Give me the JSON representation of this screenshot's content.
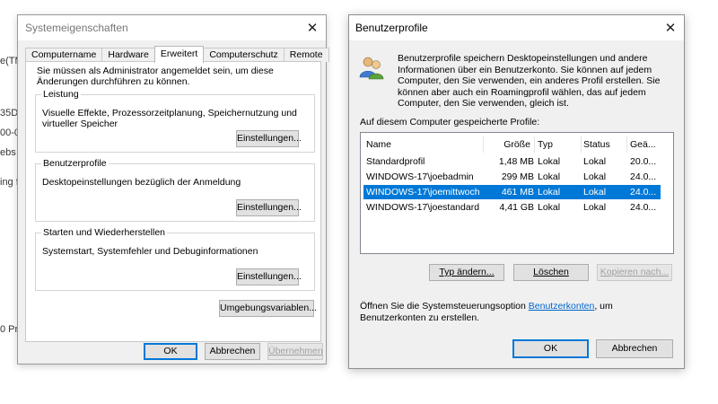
{
  "background": {
    "fragments": [
      "e(TM",
      "35D",
      "00-0",
      "ebs",
      "ing f",
      "0 Pro"
    ]
  },
  "system_properties": {
    "title": "Systemeigenschaften",
    "tabs": [
      {
        "label": "Computername",
        "active": false
      },
      {
        "label": "Hardware",
        "active": false
      },
      {
        "label": "Erweitert",
        "active": true
      },
      {
        "label": "Computerschutz",
        "active": false
      },
      {
        "label": "Remote",
        "active": false
      }
    ],
    "admin_note": "Sie müssen als Administrator angemeldet sein, um diese Änderungen durchführen zu können.",
    "groups": {
      "performance": {
        "legend": "Leistung",
        "description": "Visuelle Effekte, Prozessorzeitplanung, Speichernutzung und virtueller Speicher",
        "button": "Einstellungen..."
      },
      "user_profiles": {
        "legend": "Benutzerprofile",
        "description": "Desktopeinstellungen bezüglich der Anmeldung",
        "button": "Einstellungen..."
      },
      "startup_recovery": {
        "legend": "Starten und Wiederherstellen",
        "description": "Systemstart, Systemfehler und Debuginformationen",
        "button": "Einstellungen..."
      }
    },
    "env_button": "Umgebungsvariablen...",
    "footer": {
      "ok": "OK",
      "cancel": "Abbrechen",
      "apply": "Übernehmen"
    }
  },
  "user_profiles_dialog": {
    "title": "Benutzerprofile",
    "intro": "Benutzerprofile speichern Desktopeinstellungen und andere Informationen über ein Benutzerkonto. Sie können auf jedem Computer, den Sie verwenden, ein anderes Profil erstellen. Sie können aber auch ein Roamingprofil wählen, das auf jedem Computer, den Sie verwenden, gleich ist.",
    "list_label": "Auf diesem Computer gespeicherte Profile:",
    "columns": {
      "name": "Name",
      "size": "Größe",
      "type": "Typ",
      "status": "Status",
      "modified": "Geä..."
    },
    "rows": [
      {
        "name": "Standardprofil",
        "size": "1,48 MB",
        "type": "Lokal",
        "status": "Lokal",
        "modified": "20.0...",
        "selected": false
      },
      {
        "name": "WINDOWS-17\\joebadmin",
        "size": "299 MB",
        "type": "Lokal",
        "status": "Lokal",
        "modified": "24.0...",
        "selected": false
      },
      {
        "name": "WINDOWS-17\\joemittwoch",
        "size": "461 MB",
        "type": "Lokal",
        "status": "Lokal",
        "modified": "24.0...",
        "selected": true
      },
      {
        "name": "WINDOWS-17\\joestandard",
        "size": "4,41 GB",
        "type": "Lokal",
        "status": "Lokal",
        "modified": "24.0...",
        "selected": false
      }
    ],
    "buttons": {
      "change_type": "Typ ändern...",
      "delete": "Löschen",
      "copy_to": "Kopieren nach..."
    },
    "open_note_prefix": "Öffnen Sie die Systemsteuerungsoption ",
    "open_note_link": "Benutzerkonten",
    "open_note_suffix": ", um Benutzerkonten zu erstellen.",
    "footer": {
      "ok": "OK",
      "cancel": "Abbrechen"
    },
    "colors": {
      "selection": "#0078d7",
      "link": "#0066cc"
    }
  }
}
